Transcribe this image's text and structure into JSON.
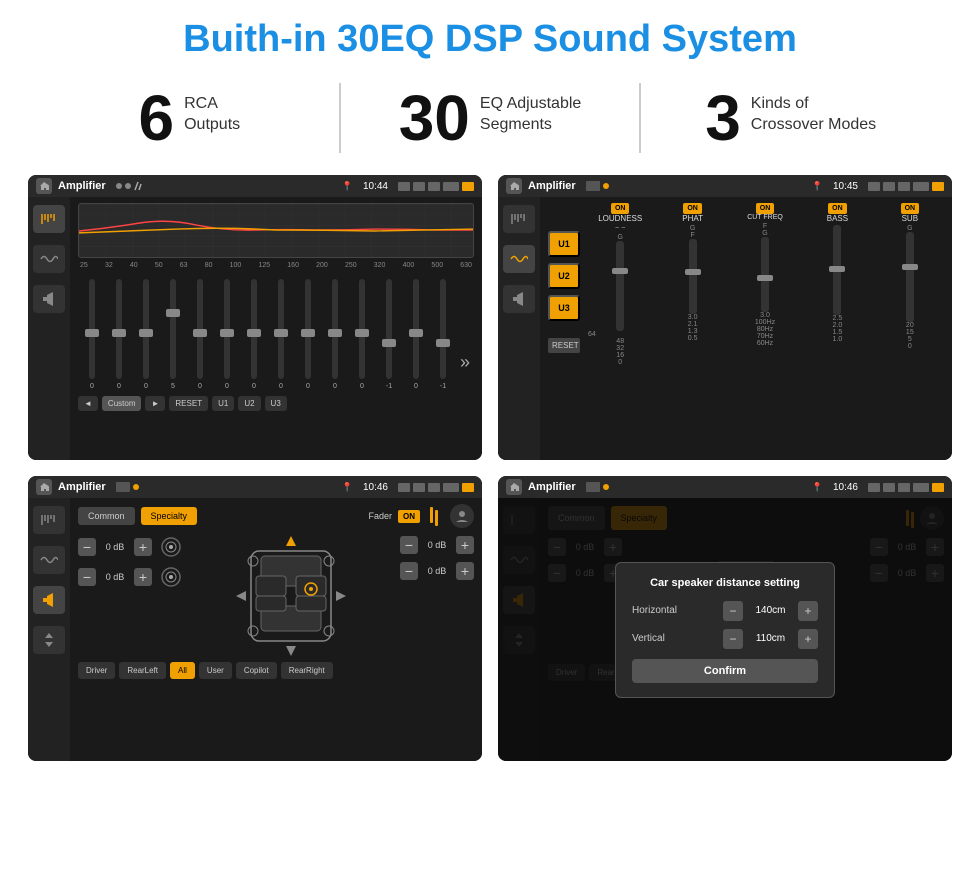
{
  "page": {
    "title": "Buith-in 30EQ DSP Sound System"
  },
  "stats": [
    {
      "number": "6",
      "label_line1": "RCA",
      "label_line2": "Outputs"
    },
    {
      "number": "30",
      "label_line1": "EQ Adjustable",
      "label_line2": "Segments"
    },
    {
      "number": "3",
      "label_line1": "Kinds of",
      "label_line2": "Crossover Modes"
    }
  ],
  "screens": [
    {
      "id": "eq-screen",
      "app_name": "Amplifier",
      "time": "10:44",
      "type": "eq",
      "freq_labels": [
        "25",
        "32",
        "40",
        "50",
        "63",
        "80",
        "100",
        "125",
        "160",
        "200",
        "250",
        "320",
        "400",
        "500",
        "630"
      ],
      "slider_values": [
        "0",
        "0",
        "0",
        "5",
        "0",
        "0",
        "0",
        "0",
        "0",
        "0",
        "0",
        "-1",
        "0",
        "-1"
      ],
      "bottom_buttons": [
        "◄",
        "Custom",
        "►",
        "RESET",
        "U1",
        "U2",
        "U3"
      ]
    },
    {
      "id": "crossover-screen",
      "app_name": "Amplifier",
      "time": "10:45",
      "type": "crossover",
      "presets": [
        "U1",
        "U2",
        "U3"
      ],
      "channels": [
        "LOUDNESS",
        "PHAT",
        "CUT FREQ",
        "BASS",
        "SUB"
      ],
      "toggles": [
        "ON",
        "ON",
        "ON",
        "ON",
        "ON"
      ],
      "reset_label": "RESET"
    },
    {
      "id": "fader-screen",
      "app_name": "Amplifier",
      "time": "10:46",
      "type": "fader",
      "tabs": [
        "Common",
        "Specialty"
      ],
      "active_tab": "Specialty",
      "fader_label": "Fader",
      "fader_on": "ON",
      "levels": [
        {
          "value": "0 dB"
        },
        {
          "value": "0 dB"
        },
        {
          "value": "0 dB"
        },
        {
          "value": "0 dB"
        }
      ],
      "bottom_buttons": [
        "Driver",
        "RearLeft",
        "All",
        "User",
        "Copilot",
        "RearRight"
      ]
    },
    {
      "id": "dialog-screen",
      "app_name": "Amplifier",
      "time": "10:46",
      "type": "dialog",
      "dialog_title": "Car speaker distance setting",
      "fields": [
        {
          "label": "Horizontal",
          "value": "140cm"
        },
        {
          "label": "Vertical",
          "value": "110cm"
        }
      ],
      "confirm_label": "Confirm",
      "tabs": [
        "Common",
        "Specialty"
      ],
      "active_tab": "Specialty"
    }
  ]
}
